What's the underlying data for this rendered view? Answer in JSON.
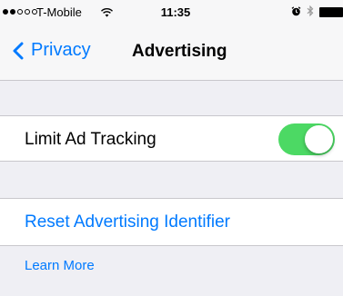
{
  "status_bar": {
    "carrier": "T-Mobile",
    "time": "11:35",
    "signal_strength": 2,
    "signal_max": 5,
    "icons": [
      "wifi-icon",
      "alarm-icon",
      "bluetooth-icon",
      "battery-icon"
    ]
  },
  "nav": {
    "back_label": "Privacy",
    "title": "Advertising"
  },
  "settings": {
    "limit_ad_tracking": {
      "label": "Limit Ad Tracking",
      "enabled": true
    },
    "reset_label": "Reset Advertising Identifier"
  },
  "footer": {
    "learn_more": "Learn More"
  },
  "colors": {
    "accent": "#007aff",
    "toggle_on": "#4cd964",
    "background": "#efeff4"
  }
}
